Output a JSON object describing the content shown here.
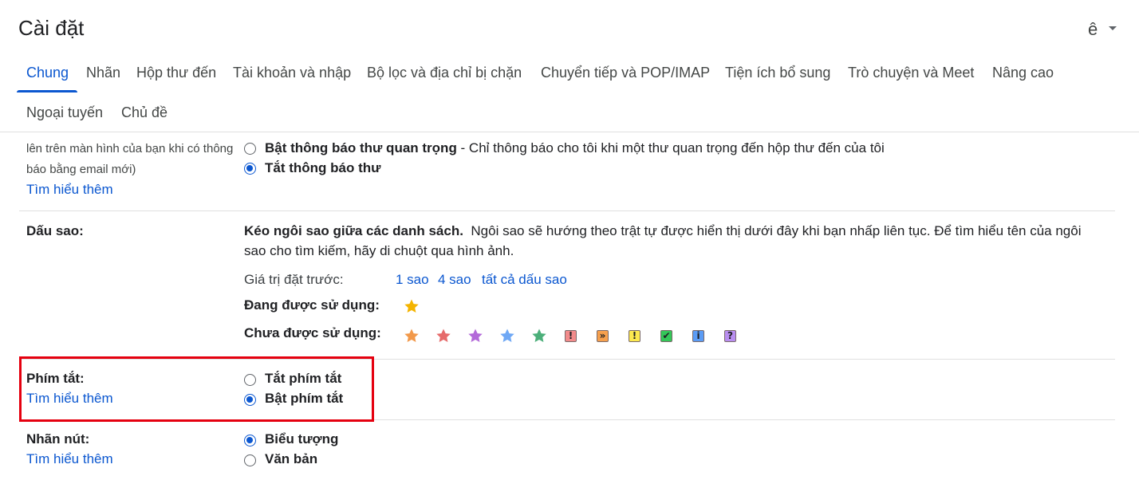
{
  "header": {
    "title": "Cài đặt",
    "lang_label": "ê"
  },
  "tabs": [
    {
      "label": "Chung",
      "active": true
    },
    {
      "label": "Nhãn"
    },
    {
      "label": "Hộp thư đến"
    },
    {
      "label": "Tài khoản và nhập"
    },
    {
      "label": "Bộ lọc và địa chỉ bị chặn"
    },
    {
      "label": "Chuyển tiếp và POP/IMAP"
    },
    {
      "label": "Tiện ích bổ sung"
    },
    {
      "label": "Trò chuyện và Meet"
    },
    {
      "label": "Nâng cao"
    },
    {
      "label": "Ngoại tuyến"
    },
    {
      "label": "Chủ đề"
    }
  ],
  "notifications": {
    "desc_line1": "lên trên màn hình của bạn khi có thông",
    "desc_line2": "báo bằng email mới)",
    "learn_more": "Tìm hiểu thêm",
    "important_bold": "Bật thông báo thư quan trọng",
    "important_rest": " - Chỉ thông báo cho tôi khi một thư quan trọng đến hộp thư đến của tôi",
    "off": "Tắt thông báo thư"
  },
  "stars": {
    "label": "Dấu sao:",
    "drag_bold": "Kéo ngôi sao giữa các danh sách.",
    "drag_rest": "Ngôi sao sẽ hướng theo trật tự được hiển thị dưới đây khi bạn nhấp liên tục. Để tìm hiểu tên của ngôi",
    "drag_line2": "sao cho tìm kiếm, hãy di chuột qua hình ảnh.",
    "presets_label": "Giá trị đặt trước:",
    "preset_1": "1 sao",
    "preset_4": "4 sao",
    "preset_all": "tất cả dấu sao",
    "in_use_label": "Đang được sử dụng:",
    "not_in_use_label": "Chưa được sử dụng:",
    "in_use_icons": [
      {
        "name": "yellow-star",
        "color": "#f4b400"
      }
    ],
    "not_in_use_icons": [
      {
        "name": "orange-star",
        "color": "#f2994a"
      },
      {
        "name": "red-star",
        "color": "#e66b6b"
      },
      {
        "name": "purple-star",
        "color": "#b36ad9"
      },
      {
        "name": "blue-star",
        "color": "#6fa8f5"
      },
      {
        "name": "green-star",
        "color": "#4caf7a"
      },
      {
        "name": "red-bang",
        "color": "#f28b8b",
        "glyph": "!"
      },
      {
        "name": "orange-guillemet",
        "color": "#f6a04d",
        "glyph": "»"
      },
      {
        "name": "yellow-bang",
        "color": "#fce94f",
        "glyph": "!"
      },
      {
        "name": "green-check",
        "color": "#34c759",
        "glyph": "✔"
      },
      {
        "name": "blue-info",
        "color": "#5b9cf5",
        "glyph": "i"
      },
      {
        "name": "purple-question",
        "color": "#b98ef0",
        "glyph": "?"
      }
    ]
  },
  "shortcuts": {
    "label": "Phím tắt:",
    "learn_more": "Tìm hiểu thêm",
    "off": "Tắt phím tắt",
    "on": "Bật phím tắt"
  },
  "button_labels": {
    "label": "Nhãn nút:",
    "learn_more": "Tìm hiểu thêm",
    "icons": "Biểu tượng",
    "text": "Văn bản"
  },
  "colors": {
    "accent": "#0b57d0",
    "highlight": "#e5000f"
  }
}
